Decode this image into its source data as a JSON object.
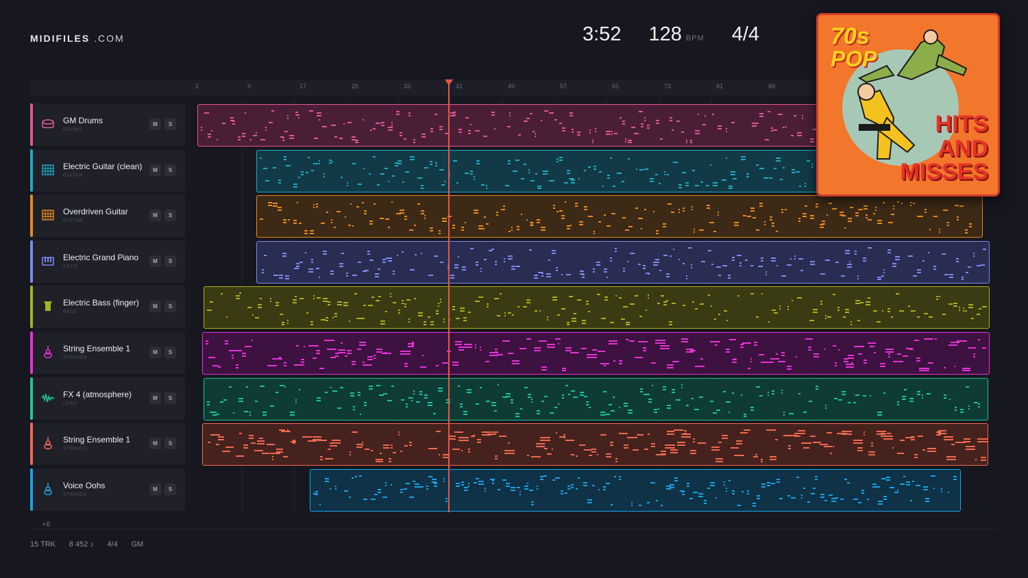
{
  "brand": {
    "name": "MIDIFILES",
    "suffix": ".COM"
  },
  "header": {
    "duration": "3:52",
    "tempo": "128",
    "tempo_unit": "BPM",
    "time_signature": "4/4"
  },
  "ruler": {
    "ticks": [
      "1",
      "9",
      "17",
      "25",
      "33",
      "41",
      "49",
      "57",
      "65",
      "73",
      "81",
      "89"
    ]
  },
  "playhead": {
    "bar": 41
  },
  "buttons": {
    "mute": "M",
    "solo": "S"
  },
  "tracks": [
    {
      "name": "GM Drums",
      "category": "DRUMS",
      "icon": "drum-icon",
      "color": "#e0569b"
    },
    {
      "name": "Electric Guitar (clean)",
      "category": "GUITAR",
      "icon": "guitar-icon",
      "color": "#1fa9c4"
    },
    {
      "name": "Overdriven Guitar",
      "category": "GUITAR",
      "icon": "guitar-icon",
      "color": "#e88a1c"
    },
    {
      "name": "Electric Grand Piano",
      "category": "KEYS",
      "icon": "piano-icon",
      "color": "#7b8cf0"
    },
    {
      "name": "Electric Bass (finger)",
      "category": "BASS",
      "icon": "bass-icon",
      "color": "#a7b320"
    },
    {
      "name": "String Ensemble 1",
      "category": "STRINGS",
      "icon": "violin-icon",
      "color": "#e832d8"
    },
    {
      "name": "FX 4 (atmosphere)",
      "category": "LEAD",
      "icon": "waveform-icon",
      "color": "#1ec2a0"
    },
    {
      "name": "String Ensemble 1",
      "category": "STRINGS",
      "icon": "violin-icon",
      "color": "#f26a50"
    },
    {
      "name": "Voice Oohs",
      "category": "STRINGS",
      "icon": "violin-icon",
      "color": "#1aa2e6"
    }
  ],
  "more_tracks": "+6",
  "footer": {
    "tracks": "15 TRK",
    "notes": "8 452 ♪",
    "time_sig": "4/4",
    "standard": "GM"
  },
  "album": {
    "line1": "70s",
    "line2": "POP",
    "line3": "HITS",
    "line4": "AND",
    "line5": "MISSES"
  }
}
